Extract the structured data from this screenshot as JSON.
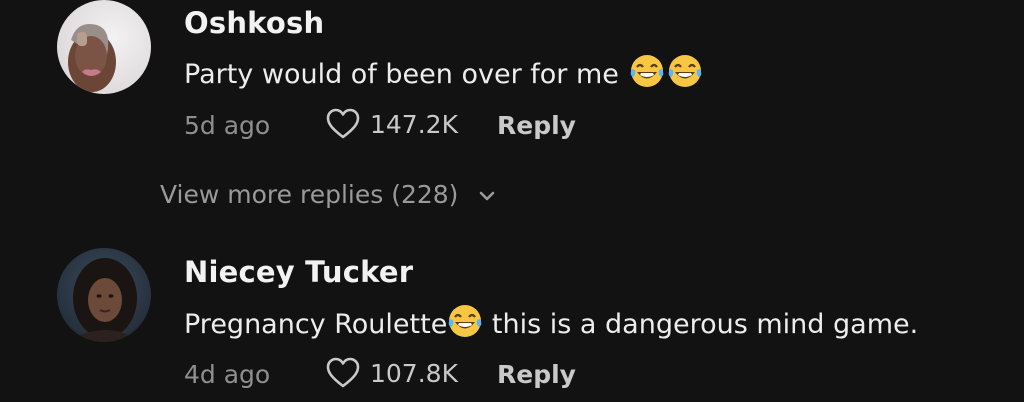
{
  "comments": [
    {
      "author": "Oshkosh",
      "text": "Party would of been over for me ",
      "emoji": [
        "face-with-tears-of-joy",
        "face-with-tears-of-joy"
      ],
      "age": "5d ago",
      "likes": "147.2K",
      "reply_label": "Reply"
    },
    {
      "author": "Niecey Tucker",
      "text_before": "Pregnancy Roulette",
      "emoji": [
        "face-with-tears-of-joy"
      ],
      "text_after": " this is a dangerous mind game.",
      "age": "4d ago",
      "likes": "107.8K",
      "reply_label": "Reply"
    }
  ],
  "view_more": {
    "label": "View more replies (228)"
  },
  "colors": {
    "background": "#121212",
    "author": "#f2f2f2",
    "meta": "#8f8f8f",
    "emoji": "#f7c744"
  }
}
